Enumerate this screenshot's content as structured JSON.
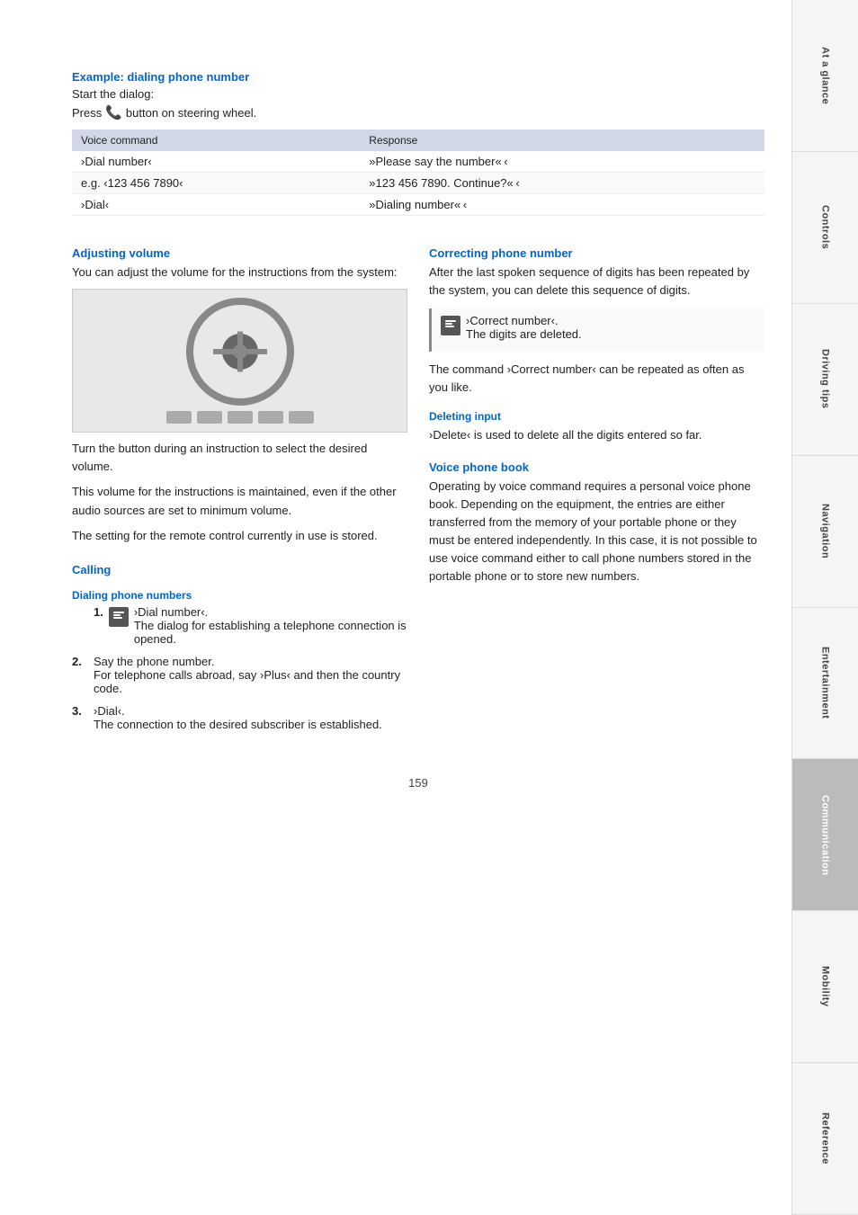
{
  "page": {
    "number": "159"
  },
  "sidebar": {
    "tabs": [
      {
        "id": "at-a-glance",
        "label": "At a glance",
        "active": false
      },
      {
        "id": "controls",
        "label": "Controls",
        "active": false
      },
      {
        "id": "driving-tips",
        "label": "Driving tips",
        "active": false
      },
      {
        "id": "navigation",
        "label": "Navigation",
        "active": false
      },
      {
        "id": "entertainment",
        "label": "Entertainment",
        "active": false
      },
      {
        "id": "communication",
        "label": "Communication",
        "active": true
      },
      {
        "id": "mobility",
        "label": "Mobility",
        "active": false
      },
      {
        "id": "reference",
        "label": "Reference",
        "active": false
      }
    ]
  },
  "example_section": {
    "title": "Example: dialing phone number",
    "intro1": "Start the dialog:",
    "intro2": "Press",
    "intro2b": "button on steering wheel.",
    "table": {
      "col1": "Voice command",
      "col2": "Response",
      "rows": [
        {
          "cmd": "›Dial number‹",
          "response": "»Please say the number« ‹"
        },
        {
          "cmd": "e.g. ‹123 456 7890‹",
          "response": "»123 456 7890. Continue?« ‹"
        },
        {
          "cmd": "›Dial‹",
          "response": "»Dialing number« ‹"
        }
      ]
    }
  },
  "adjusting_volume": {
    "title": "Adjusting volume",
    "body1": "You can adjust the volume for the instructions from the system:",
    "body2": "Turn the button during an instruction to select the desired volume.",
    "body3": "This volume for the instructions is maintained, even if the other audio sources are set to minimum volume.",
    "body4": "The setting for the remote control currently in use is stored."
  },
  "correcting_phone": {
    "title": "Correcting phone number",
    "body1": "After the last spoken sequence of digits has been repeated by the system, you can delete this sequence of digits.",
    "icon_cmd": "›Correct number‹.",
    "icon_sub": "The digits are deleted.",
    "body2": "The command ›Correct number‹ can be repeated as often as you like."
  },
  "deleting_input": {
    "title": "Deleting input",
    "body": "›Delete‹ is used to delete all the digits entered so far."
  },
  "voice_phone_book": {
    "title": "Voice phone book",
    "body": "Operating by voice command requires a personal voice phone book. Depending on the equipment, the entries are either transferred from the memory of your portable phone or they must be entered independently. In this case, it is not possible to use voice command either to call phone numbers stored in the portable phone or to store new numbers."
  },
  "calling": {
    "title": "Calling",
    "subtitle": "Dialing phone numbers",
    "steps": [
      {
        "num": "1.",
        "has_icon": true,
        "main": "›Dial number‹.",
        "sub": "The dialog for establishing a telephone connection is opened."
      },
      {
        "num": "2.",
        "has_icon": false,
        "main": "Say the phone number.",
        "sub": "For telephone calls abroad, say ›Plus‹ and then the country code."
      },
      {
        "num": "3.",
        "has_icon": false,
        "main": "›Dial‹.",
        "sub": "The connection to the desired subscriber is established."
      }
    ]
  }
}
